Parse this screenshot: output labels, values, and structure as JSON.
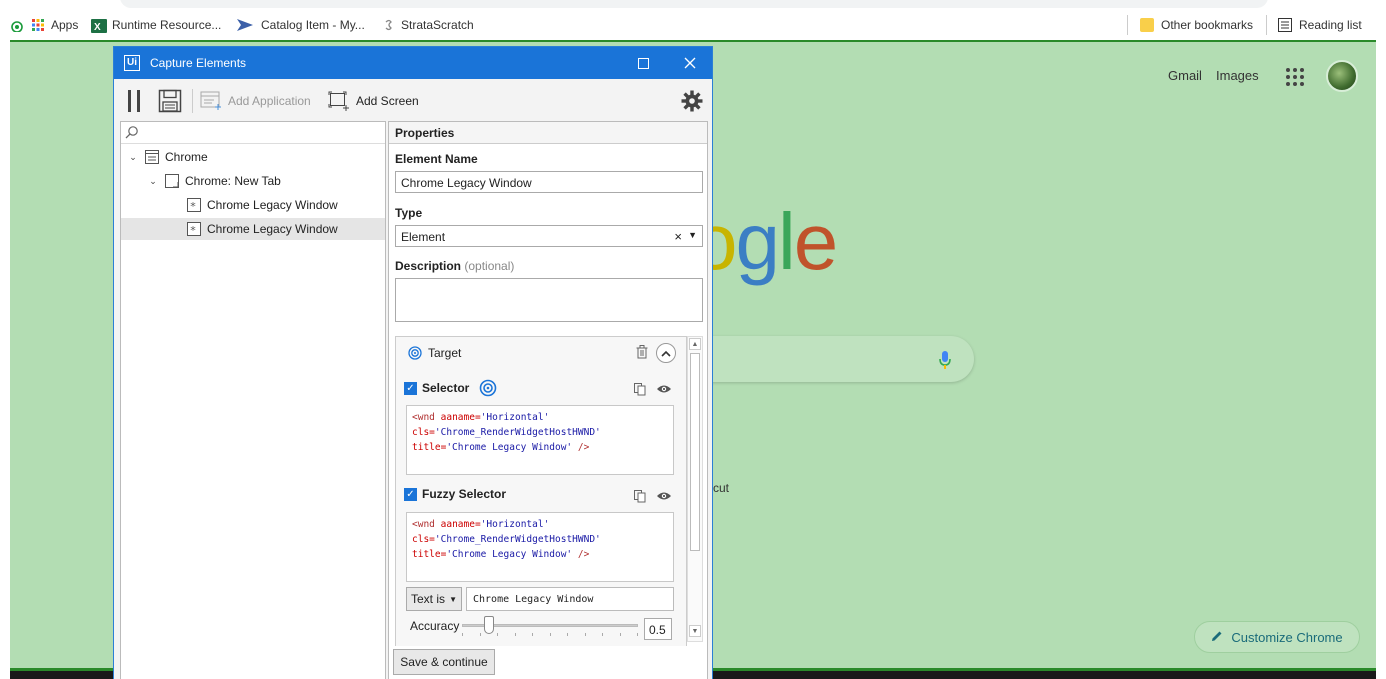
{
  "bookmarks": {
    "apps": "Apps",
    "items": [
      "Runtime Resource...",
      "Catalog Item - My...",
      "StrataScratch"
    ],
    "other": "Other bookmarks",
    "reading_list": "Reading list"
  },
  "ntp": {
    "gmail": "Gmail",
    "images": "Images",
    "logo_fragment": [
      "o",
      "g",
      "l",
      "e"
    ],
    "cut_text": "cut",
    "customize": "Customize Chrome"
  },
  "dialog": {
    "title": "Capture Elements",
    "toolbar": {
      "add_application": "Add Application",
      "add_screen": "Add Screen"
    },
    "tree": {
      "nodes": [
        {
          "label": "Chrome",
          "level": 0,
          "expanded": true
        },
        {
          "label": "Chrome: New Tab",
          "level": 1,
          "expanded": true
        },
        {
          "label": "Chrome Legacy Window",
          "level": 2
        },
        {
          "label": "Chrome Legacy Window",
          "level": 2,
          "selected": true
        }
      ]
    },
    "properties": {
      "header": "Properties",
      "element_name_label": "Element Name",
      "element_name_value": "Chrome Legacy Window",
      "type_label": "Type",
      "type_value": "Element",
      "description_label": "Description",
      "description_optional": "(optional)",
      "target": {
        "label": "Target",
        "selector_label": "Selector",
        "selector_line1_tag": "<wnd",
        "selector_line1_attr": "aaname=",
        "selector_line1_val": "'Horizontal'",
        "selector_line2_attr": "cls=",
        "selector_line2_val": "'Chrome_RenderWidgetHostHWND'",
        "selector_line3_attr": "title=",
        "selector_line3_val": "'Chrome Legacy Window'",
        "selector_line3_end": " />",
        "fuzzy_label": "Fuzzy Selector",
        "text_is": "Text is",
        "text_value": "Chrome Legacy Window",
        "accuracy_label": "Accuracy",
        "accuracy_value": "0.5"
      }
    },
    "save_button": "Save & continue"
  },
  "colors": {
    "dialog_title_bg": "#1a74d8",
    "ntp_bg": "#b3ddb3",
    "accent": "#1a74d8"
  }
}
